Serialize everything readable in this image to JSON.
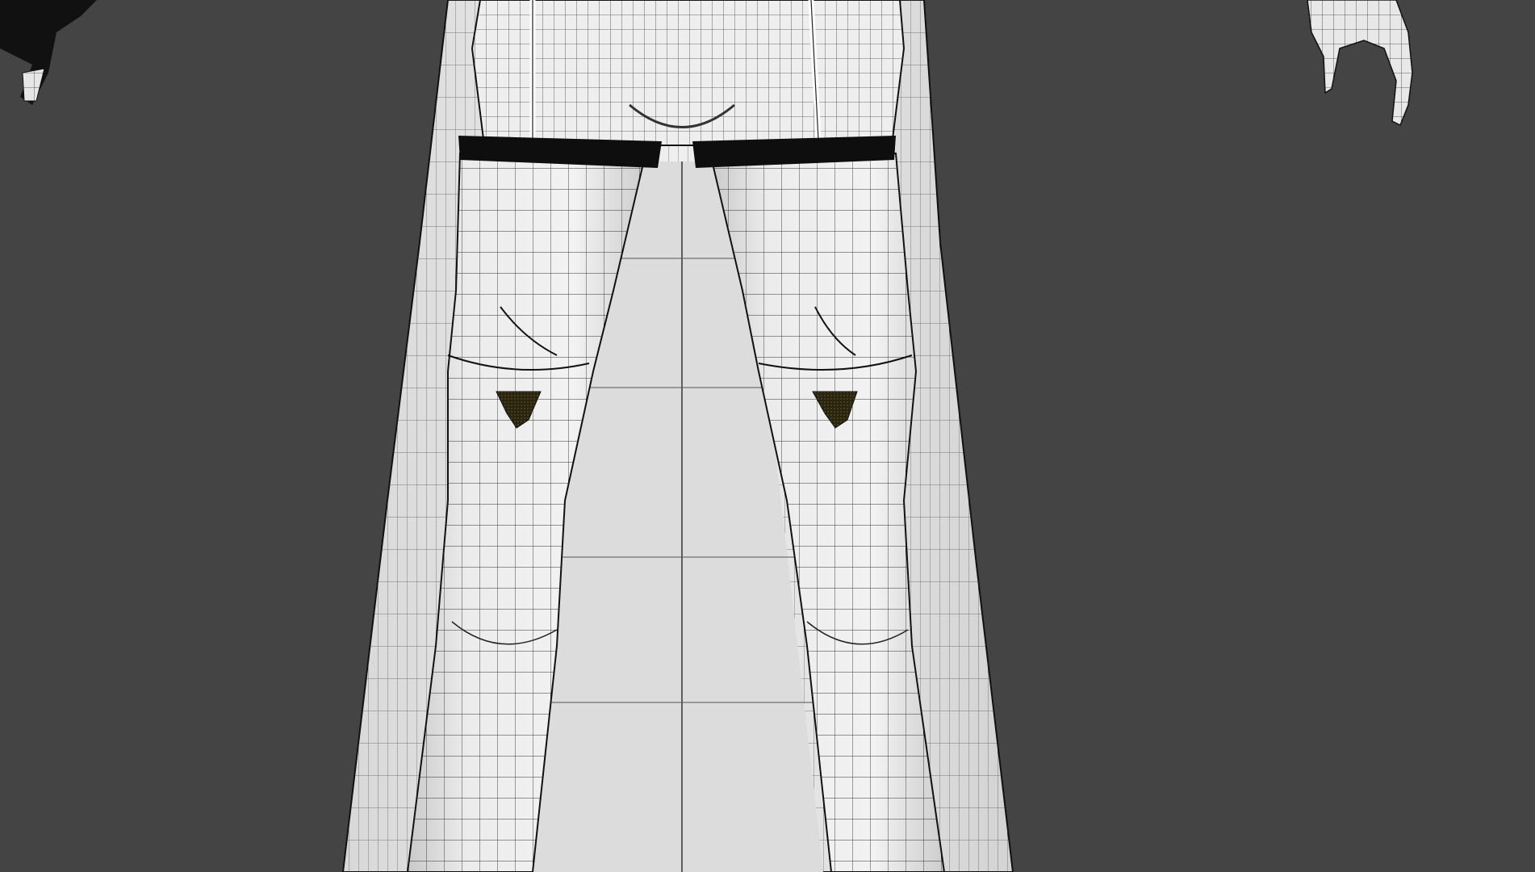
{
  "app": {
    "window_title": "",
    "view_mode": "wireframe-on-shaded"
  },
  "viewport": {
    "background": "#444444",
    "mesh_fill": "#e6e6e6",
    "mesh_shadow": "#cfcfcf",
    "wire_color": "#1c1c1c",
    "accent_dark": "#0e0e0e",
    "floor_plane": "#dcdcdc"
  },
  "objects": [
    {
      "name": "cape"
    },
    {
      "name": "left-leg"
    },
    {
      "name": "right-leg"
    },
    {
      "name": "garter-belt"
    },
    {
      "name": "left-hand"
    },
    {
      "name": "right-hand"
    },
    {
      "name": "floor-grid"
    }
  ]
}
